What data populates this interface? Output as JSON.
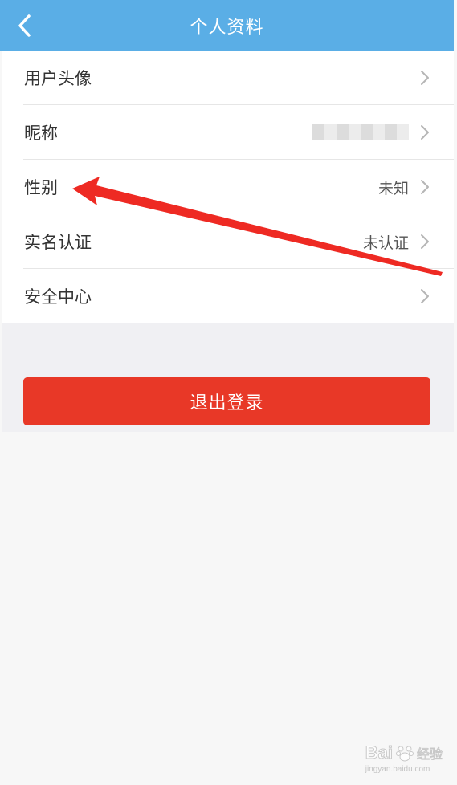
{
  "header": {
    "title": "个人资料",
    "back_icon": "chevron-left-icon",
    "background": "#5aaee6"
  },
  "profile_items": [
    {
      "label": "用户头像",
      "value": ""
    },
    {
      "label": "昵称",
      "value": ""
    },
    {
      "label": "性别",
      "value": "未知"
    },
    {
      "label": "实名认证",
      "value": "未认证"
    },
    {
      "label": "安全中心",
      "value": ""
    }
  ],
  "logout": {
    "label": "退出登录",
    "color": "#e83827"
  },
  "annotation": {
    "color": "#ee2a23"
  },
  "watermark": {
    "brand": "Bai",
    "cn": "经验",
    "url": "jingyan.baidu.com"
  }
}
